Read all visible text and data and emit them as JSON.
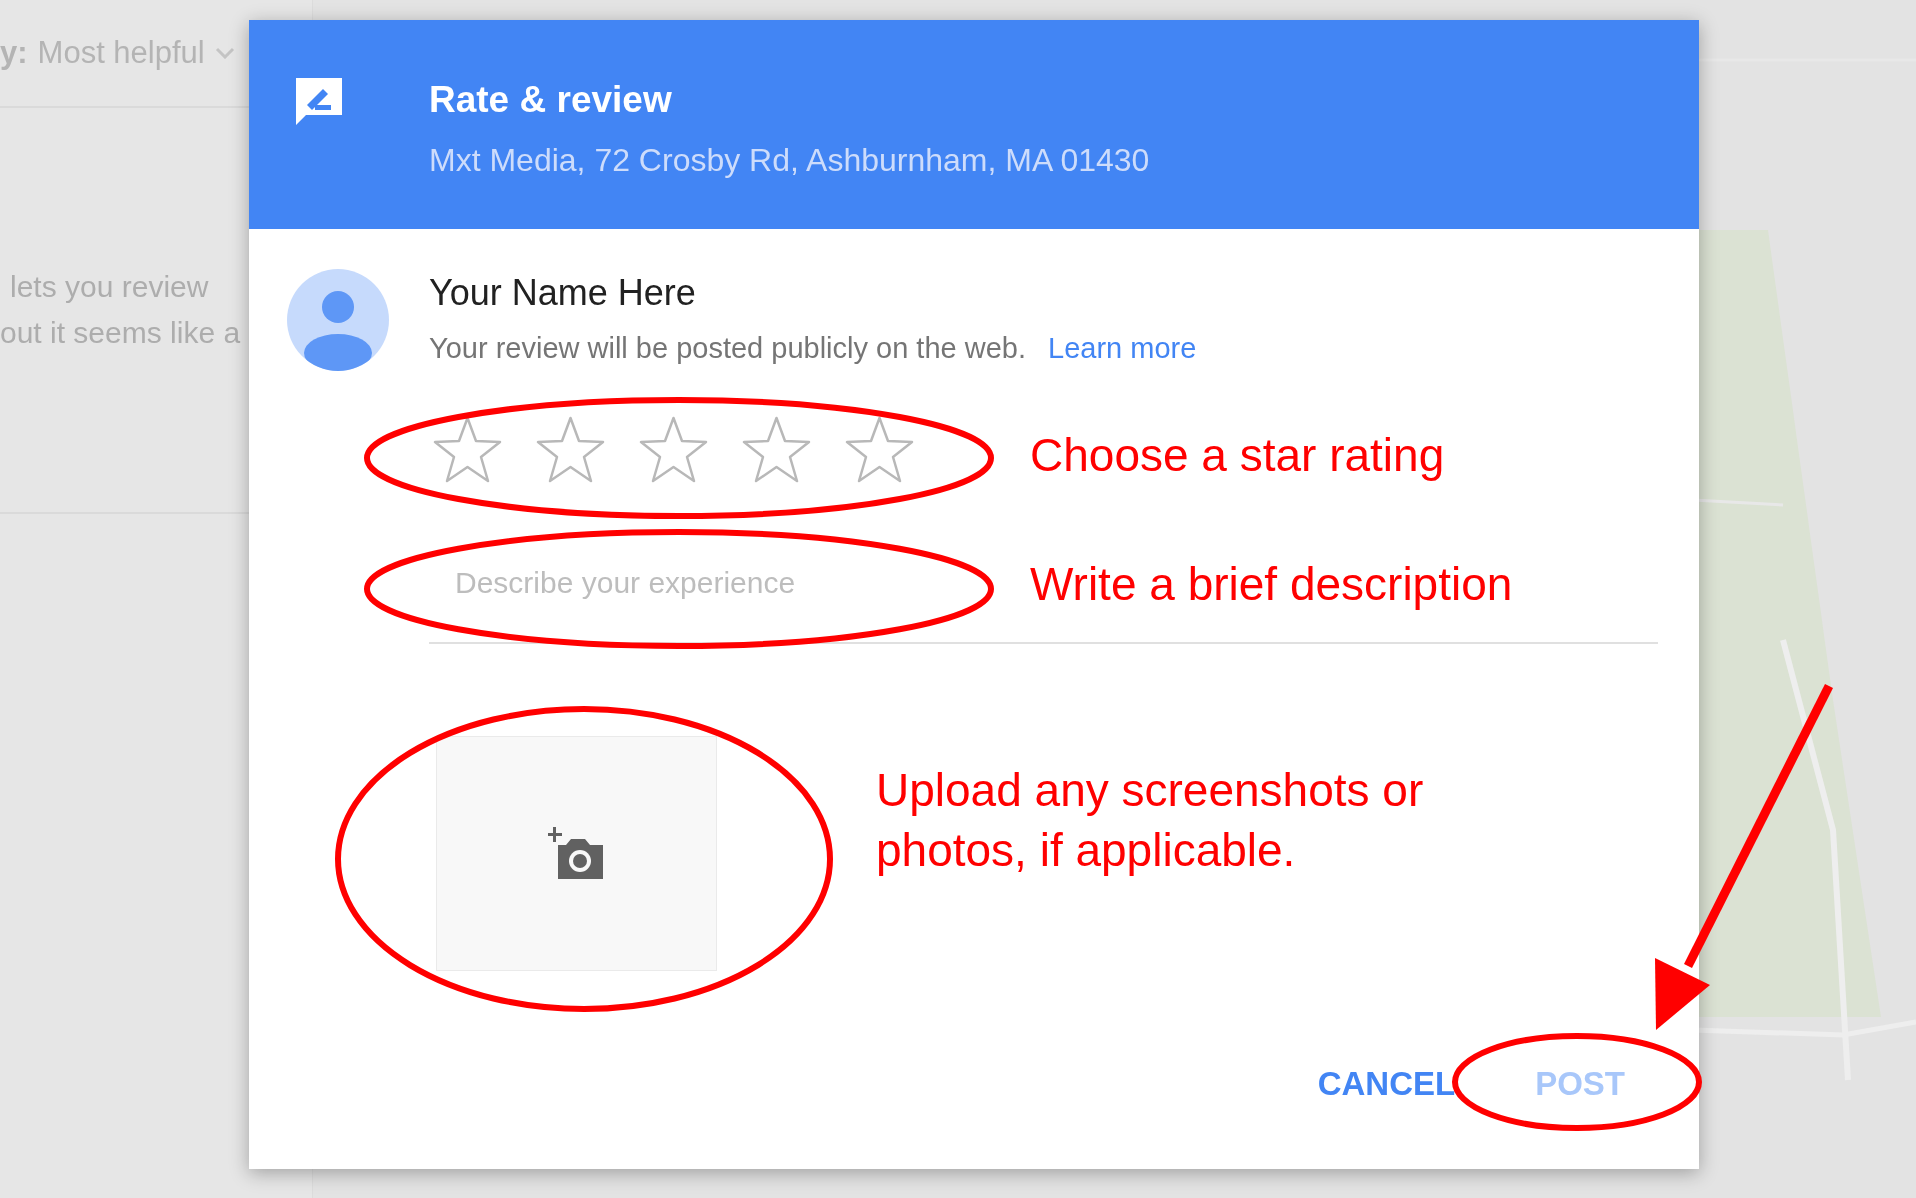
{
  "background": {
    "sort_label": "y:",
    "sort_value": "Most helpful",
    "text_lines": [
      "lets you review",
      "out it seems like a"
    ]
  },
  "dialog": {
    "title": "Rate & review",
    "subtitle": "Mxt Media, 72 Crosby Rd, Ashburnham, MA 01430",
    "user_name": "Your Name Here",
    "notice": "Your review will be posted publicly on the web.",
    "learn_more": "Learn more",
    "rating": {
      "stars": 0
    },
    "description": {
      "placeholder": "Describe your experience"
    },
    "buttons": [
      {
        "label": "CANCEL",
        "disabled": false
      },
      {
        "label": "POST",
        "disabled": true
      }
    ]
  },
  "annotations": [
    "Choose a star rating",
    "Write a brief description",
    "Upload any screenshots or photos, if applicable."
  ]
}
